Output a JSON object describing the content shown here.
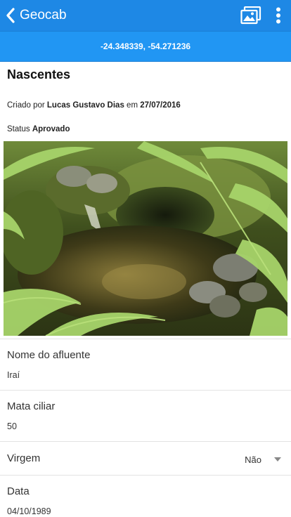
{
  "appbar": {
    "title": "Geocab",
    "back_icon": "chevron-left-icon",
    "gallery_icon": "image-gallery-icon",
    "more_icon": "more-vertical-icon",
    "color": "#1e88e5"
  },
  "coords": {
    "text": "-24.348339, -54.271236",
    "color": "#2196f3"
  },
  "record": {
    "title": "Nascentes",
    "created_prefix": "Criado por",
    "author": "Lucas Gustavo Dias",
    "created_mid": "em",
    "date": "27/07/2016",
    "status_label": "Status",
    "status_value": "Aprovado"
  },
  "fields": [
    {
      "label": "Nome do afluente",
      "value": "Iraí"
    },
    {
      "label": "Mata ciliar",
      "value": "50"
    },
    {
      "label": "Virgem",
      "value": "Não"
    },
    {
      "label": "Data",
      "value": "04/10/1989"
    }
  ]
}
